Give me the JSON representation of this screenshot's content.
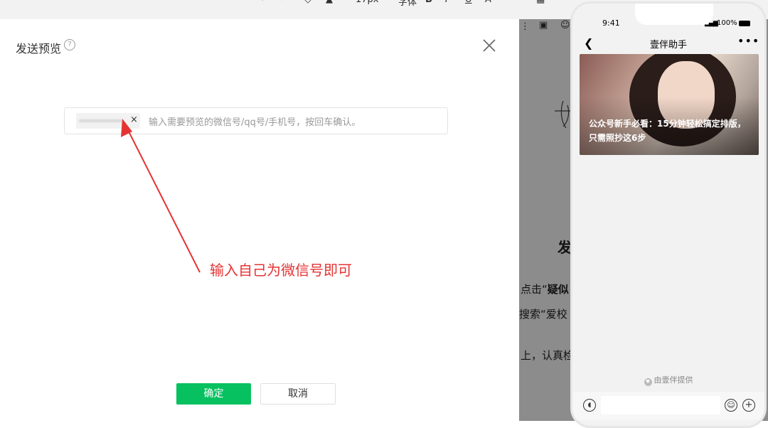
{
  "modal": {
    "title": "发送预览",
    "help_icon": "question-circle-icon",
    "close_icon": "close-icon",
    "input": {
      "placeholder": "输入需要预览的微信号/qq号/手机号，按回车确认。",
      "tag_remove": "×"
    },
    "annotation": "输入自己为微信号即可",
    "confirm_label": "确定",
    "cancel_label": "取消",
    "colors": {
      "confirm": "#07c160",
      "annotation": "#e53333"
    }
  },
  "editor": {
    "toolbar_size": "17px",
    "toolbar_font": "字体",
    "heading_fragment": "发",
    "line1": "点击“",
    "line1_bold": "疑似",
    "line2": "搜索“爱校",
    "line3": "上，认真检"
  },
  "phone": {
    "time": "9:41",
    "battery": "100%",
    "nav_title": "壹伴助手",
    "back_icon": "back-arrow-icon",
    "more_icon": "more-icon",
    "more_text": "•••",
    "card_title": "公众号新手必看：15分钟轻松搞定排版，只需照抄这6步",
    "provider": "由壹伴提供",
    "voice_icon": "voice-icon",
    "emoji_icon": "emoji-icon",
    "plus_icon": "plus-icon"
  }
}
